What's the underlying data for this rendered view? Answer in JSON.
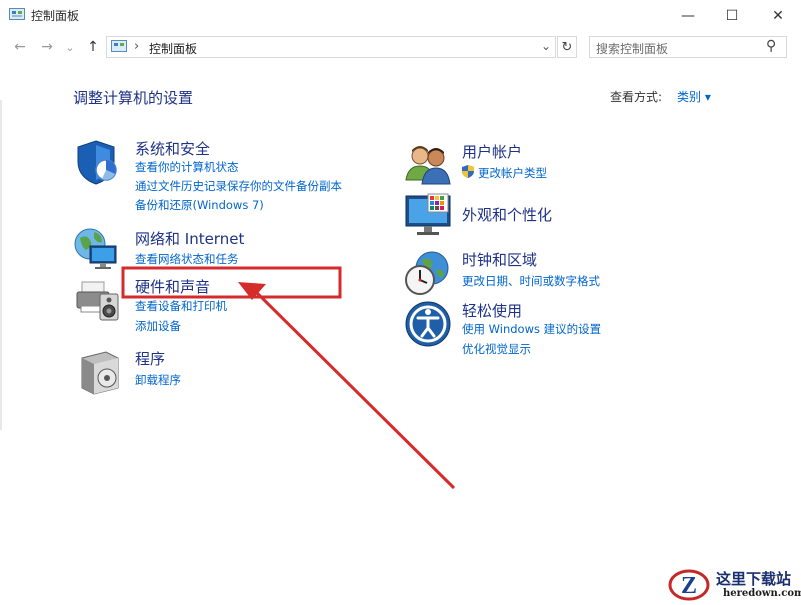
{
  "window": {
    "title": "控制面板",
    "minimize_icon": "—",
    "maximize_icon": "☐",
    "close_icon": "✕"
  },
  "nav": {
    "back_icon": "←",
    "forward_icon": "→",
    "recent_icon": "⌄",
    "up_icon": "↑"
  },
  "address": {
    "separator": "›",
    "path": "控制面板",
    "dropdown_icon": "⌄",
    "refresh_icon": "↻"
  },
  "search": {
    "placeholder": "搜索控制面板",
    "icon": "⚲"
  },
  "header": {
    "title": "调整计算机的设置",
    "view_by_label": "查看方式:",
    "view_by_value": "类别 ▾"
  },
  "categories_left": [
    {
      "title": "系统和安全",
      "links": [
        "查看你的计算机状态",
        "通过文件历史记录保存你的文件备份副本",
        "备份和还原(Windows 7)"
      ]
    },
    {
      "title": "网络和 Internet",
      "links": [
        "查看网络状态和任务"
      ]
    },
    {
      "title": "硬件和声音",
      "links": [
        "查看设备和打印机",
        "添加设备"
      ]
    },
    {
      "title": "程序",
      "links": [
        "卸载程序"
      ]
    }
  ],
  "categories_right": [
    {
      "title": "用户帐户",
      "links": [
        "更改帐户类型"
      ]
    },
    {
      "title": "外观和个性化",
      "links": []
    },
    {
      "title": "时钟和区域",
      "links": [
        "更改日期、时间或数字格式"
      ]
    },
    {
      "title": "轻松使用",
      "links": [
        "使用 Windows 建议的设置",
        "优化视觉显示"
      ]
    }
  ],
  "annotation": {
    "highlight_color": "#d62b2b"
  },
  "watermark": {
    "logo_letter": "Z",
    "name": "这里下载站",
    "url": "heredown.com"
  }
}
